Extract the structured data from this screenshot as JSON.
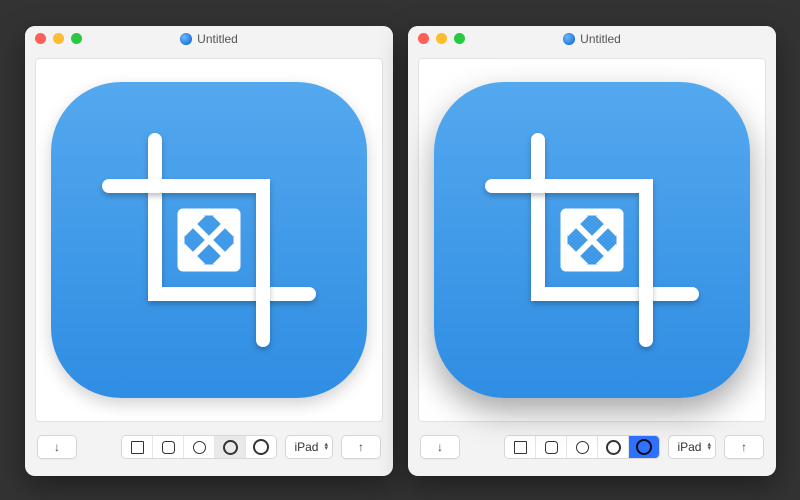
{
  "windows": {
    "left": {
      "title": "Untitled",
      "device_label": "iPad",
      "selected_mask_index": 3,
      "selection_style": "light"
    },
    "right": {
      "title": "Untitled",
      "device_label": "iPad",
      "selected_mask_index": 4,
      "selection_style": "blue"
    }
  },
  "mask_options": [
    "square-sharp",
    "square-round",
    "circle-thin",
    "circle-med",
    "circle-bold"
  ],
  "icons": {
    "document": "document-icon",
    "export": "arrow-down-icon",
    "share": "arrow-up-icon"
  },
  "colors": {
    "accent": "#2f72ff",
    "icon_bg_top": "#54a8ee",
    "icon_bg_bottom": "#2f8de3"
  }
}
